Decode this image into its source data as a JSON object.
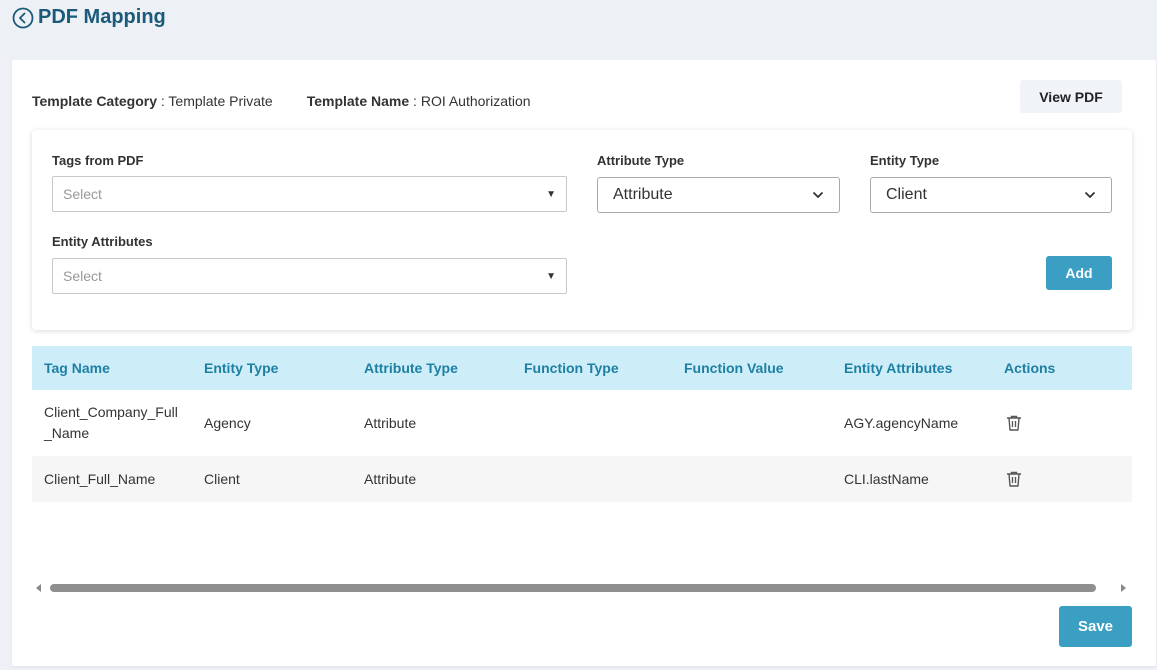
{
  "header": {
    "title": "PDF Mapping",
    "back_icon": "chevron-left-circle-icon"
  },
  "meta": {
    "template_category_label": "Template Category",
    "template_category_value": "Template Private",
    "template_name_label": "Template Name",
    "template_name_value": "ROI Authorization",
    "separator": " : "
  },
  "toolbar": {
    "view_pdf_label": "View PDF"
  },
  "form": {
    "tags_from_pdf": {
      "label": "Tags from PDF",
      "placeholder": "Select"
    },
    "attribute_type": {
      "label": "Attribute Type",
      "value": "Attribute"
    },
    "entity_type": {
      "label": "Entity Type",
      "value": "Client"
    },
    "entity_attributes": {
      "label": "Entity Attributes",
      "placeholder": "Select"
    },
    "add_label": "Add"
  },
  "table": {
    "columns": [
      "Tag Name",
      "Entity Type",
      "Attribute Type",
      "Function Type",
      "Function Value",
      "Entity Attributes",
      "Actions"
    ],
    "rows": [
      {
        "tag_name_line1": "Client_Company_Full",
        "tag_name_line2": "_Name",
        "entity_type": "Agency",
        "attribute_type": "Attribute",
        "function_type": "",
        "function_value": "",
        "entity_attributes": "AGY.agencyName",
        "action_icon": "trash-icon"
      },
      {
        "tag_name_line1": "Client_Full_Name",
        "tag_name_line2": "",
        "entity_type": "Client",
        "attribute_type": "Attribute",
        "function_type": "",
        "function_value": "",
        "entity_attributes": "CLI.lastName",
        "action_icon": "trash-icon"
      }
    ]
  },
  "footer": {
    "save_label": "Save"
  },
  "colors": {
    "accent": "#3a9fc3",
    "title": "#1a5a7a",
    "table_header_bg": "#cdeef8",
    "table_header_text": "#1f7fa3",
    "page_bg": "#edf0f5"
  }
}
